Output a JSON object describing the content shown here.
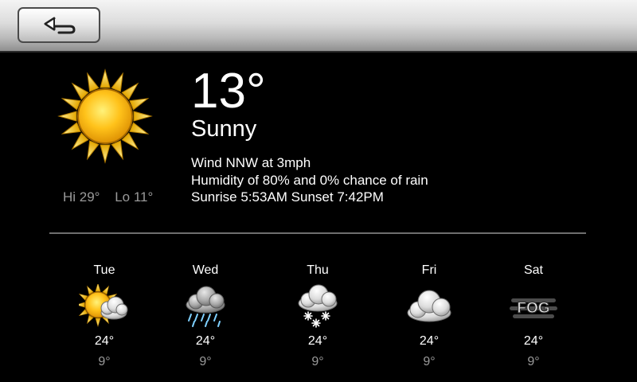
{
  "current": {
    "temperature": "13°",
    "condition": "Sunny",
    "icon": "sunny-icon",
    "hi": "Hi 29°",
    "lo": "Lo 11°",
    "wind": "Wind NNW at 3mph",
    "humidity": "Humidity of 80% and 0% chance of rain",
    "sun": "Sunrise 5:53AM Sunset 7:42PM"
  },
  "forecast": [
    {
      "day": "Tue",
      "icon": "partly-sunny-icon",
      "hi": "24°",
      "lo": "9°"
    },
    {
      "day": "Wed",
      "icon": "rain-icon",
      "hi": "24°",
      "lo": "9°"
    },
    {
      "day": "Thu",
      "icon": "snow-icon",
      "hi": "24°",
      "lo": "9°"
    },
    {
      "day": "Fri",
      "icon": "cloudy-icon",
      "hi": "24°",
      "lo": "9°"
    },
    {
      "day": "Sat",
      "icon": "fog-icon",
      "icon_text": "FOG",
      "hi": "24°",
      "lo": "9°"
    }
  ],
  "colors": {
    "background": "#000000",
    "text": "#ffffff",
    "muted_text": "#9a9a9a",
    "sun": "#f5b70d",
    "toolbar": "#d8d8d8"
  }
}
